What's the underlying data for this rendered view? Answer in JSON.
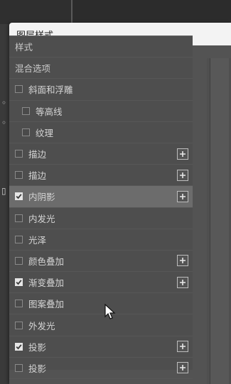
{
  "dialog": {
    "title": "图层样式"
  },
  "style_list": {
    "items": [
      {
        "label": "样式",
        "type": "header"
      },
      {
        "label": "混合选项",
        "type": "header"
      },
      {
        "label": "斜面和浮雕",
        "checked": false,
        "level": 1,
        "plus": false
      },
      {
        "label": "等高线",
        "checked": false,
        "level": 2,
        "plus": false
      },
      {
        "label": "纹理",
        "checked": false,
        "level": 2,
        "plus": false
      },
      {
        "label": "描边",
        "checked": false,
        "level": 1,
        "plus": true
      },
      {
        "label": "描边",
        "checked": false,
        "level": 1,
        "plus": true
      },
      {
        "label": "内阴影",
        "checked": true,
        "level": 1,
        "plus": true,
        "active": true
      },
      {
        "label": "内发光",
        "checked": false,
        "level": 1,
        "plus": false
      },
      {
        "label": "光泽",
        "checked": false,
        "level": 1,
        "plus": false
      },
      {
        "label": "颜色叠加",
        "checked": false,
        "level": 1,
        "plus": true
      },
      {
        "label": "渐变叠加",
        "checked": true,
        "level": 1,
        "plus": true
      },
      {
        "label": "图案叠加",
        "checked": false,
        "level": 1,
        "plus": false
      },
      {
        "label": "外发光",
        "checked": false,
        "level": 1,
        "plus": false
      },
      {
        "label": "投影",
        "checked": true,
        "level": 1,
        "plus": true
      },
      {
        "label": "投影",
        "checked": false,
        "level": 1,
        "plus": true
      }
    ]
  },
  "icons": {
    "checkbox": "checkbox-icon",
    "plus": "plus-icon",
    "cursor": "mouse-pointer-icon"
  },
  "colors": {
    "panel_bg": "#535353",
    "active_row": "#6c6c6c",
    "title_bar": "#f3f3f3",
    "text": "#d4d4d4"
  }
}
